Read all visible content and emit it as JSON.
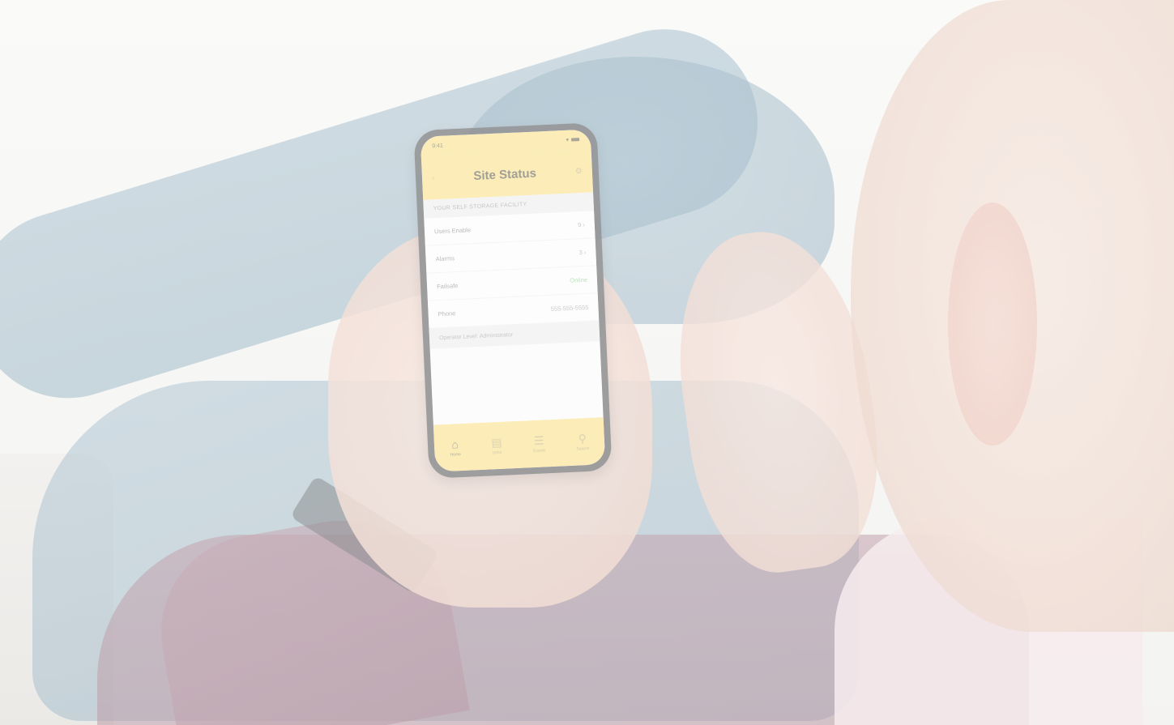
{
  "screen": {
    "title": "Site Status",
    "time": "9:41",
    "section_header": "YOUR SELF STORAGE FACILITY",
    "rows": [
      {
        "label": "Users Enable",
        "value": "9 ›"
      },
      {
        "label": "Alarms",
        "value": "3 ›"
      },
      {
        "label": "Failsafe",
        "value": "Online"
      },
      {
        "label": "Phone",
        "value": "555-555-5555"
      }
    ],
    "operator_level": "Operator Level: Administrator",
    "tabs": [
      {
        "label": "Home",
        "icon": "home-icon"
      },
      {
        "label": "Units",
        "icon": "unit-icon"
      },
      {
        "label": "Events",
        "icon": "list-icon"
      },
      {
        "label": "Search",
        "icon": "search-icon"
      }
    ]
  },
  "colors": {
    "accent_yellow": "#f8df86",
    "ok_green": "#8ccf8c"
  }
}
